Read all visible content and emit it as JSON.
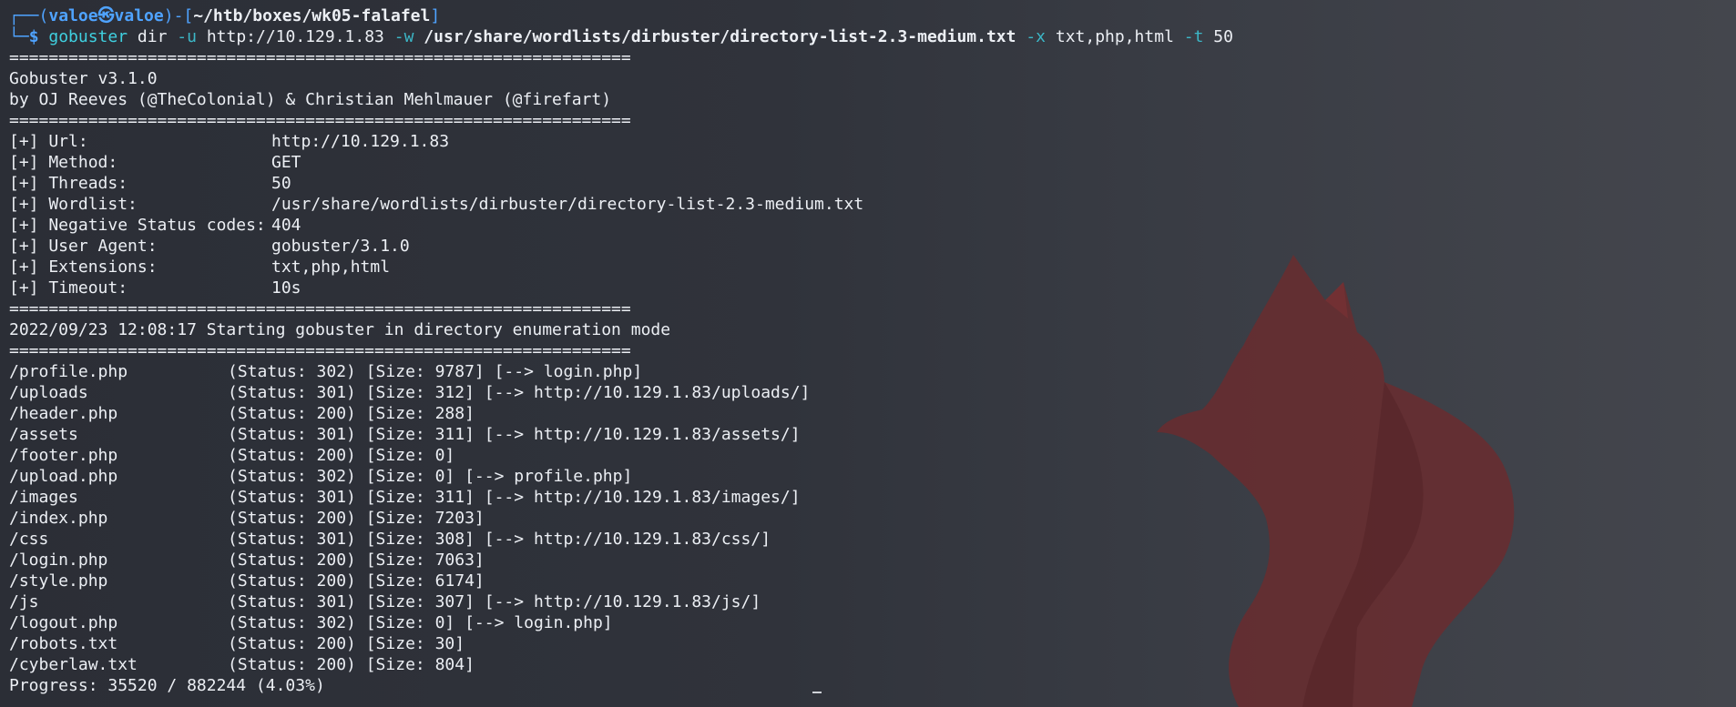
{
  "prompt": {
    "corner_top": "┌──(",
    "user": "valoe",
    "at": "㉿",
    "host": "valoe",
    "close_paren": ")-[",
    "path": "~/htb/boxes/wk05-falafel",
    "close_bracket": "]",
    "corner_bottom": "└─",
    "dollar": "$"
  },
  "command": {
    "cmd": "gobuster",
    "sub": "dir",
    "flag_u": "-u",
    "url": "http://10.129.1.83",
    "flag_w": "-w",
    "wordlist": "/usr/share/wordlists/dirbuster/directory-list-2.3-medium.txt",
    "flag_x": "-x",
    "extensions": "txt,php,html",
    "flag_t": "-t",
    "threads": "50"
  },
  "separator": "===============================================================",
  "banner": {
    "version": "Gobuster v3.1.0",
    "authors": "by OJ Reeves (@TheColonial) & Christian Mehlmauer (@firefart)"
  },
  "config": [
    {
      "key": "[+] Url:",
      "value": "http://10.129.1.83"
    },
    {
      "key": "[+] Method:",
      "value": "GET"
    },
    {
      "key": "[+] Threads:",
      "value": "50"
    },
    {
      "key": "[+] Wordlist:",
      "value": "/usr/share/wordlists/dirbuster/directory-list-2.3-medium.txt"
    },
    {
      "key": "[+] Negative Status codes:",
      "value": "404"
    },
    {
      "key": "[+] User Agent:",
      "value": "gobuster/3.1.0"
    },
    {
      "key": "[+] Extensions:",
      "value": "txt,php,html"
    },
    {
      "key": "[+] Timeout:",
      "value": "10s"
    }
  ],
  "start_message": "2022/09/23 12:08:17 Starting gobuster in directory enumeration mode",
  "results": [
    {
      "path": "/profile.php",
      "info": "(Status: 302) [Size: 9787] [--> login.php]"
    },
    {
      "path": "/uploads",
      "info": "(Status: 301) [Size: 312] [--> http://10.129.1.83/uploads/]"
    },
    {
      "path": "/header.php",
      "info": "(Status: 200) [Size: 288]"
    },
    {
      "path": "/assets",
      "info": "(Status: 301) [Size: 311] [--> http://10.129.1.83/assets/]"
    },
    {
      "path": "/footer.php",
      "info": "(Status: 200) [Size: 0]"
    },
    {
      "path": "/upload.php",
      "info": "(Status: 302) [Size: 0] [--> profile.php]"
    },
    {
      "path": "/images",
      "info": "(Status: 301) [Size: 311] [--> http://10.129.1.83/images/]"
    },
    {
      "path": "/index.php",
      "info": "(Status: 200) [Size: 7203]"
    },
    {
      "path": "/css",
      "info": "(Status: 301) [Size: 308] [--> http://10.129.1.83/css/]"
    },
    {
      "path": "/login.php",
      "info": "(Status: 200) [Size: 7063]"
    },
    {
      "path": "/style.php",
      "info": "(Status: 200) [Size: 6174]"
    },
    {
      "path": "/js",
      "info": "(Status: 301) [Size: 307] [--> http://10.129.1.83/js/]"
    },
    {
      "path": "/logout.php",
      "info": "(Status: 302) [Size: 0] [--> login.php]"
    },
    {
      "path": "/robots.txt",
      "info": "(Status: 200) [Size: 30]"
    },
    {
      "path": "/cyberlaw.txt",
      "info": "(Status: 200) [Size: 804]"
    }
  ],
  "progress": "Progress: 35520 / 882244 (4.03%)",
  "colors": {
    "prompt_blue": "#4fa3ff",
    "command_cyan": "#3fd0e0",
    "flag_teal": "#3cb7c7",
    "text": "#eceff4",
    "fox_red": "#7a2a2c"
  },
  "icons": {
    "wallpaper": "fox-wallpaper-icon",
    "cursor": "text-cursor"
  }
}
